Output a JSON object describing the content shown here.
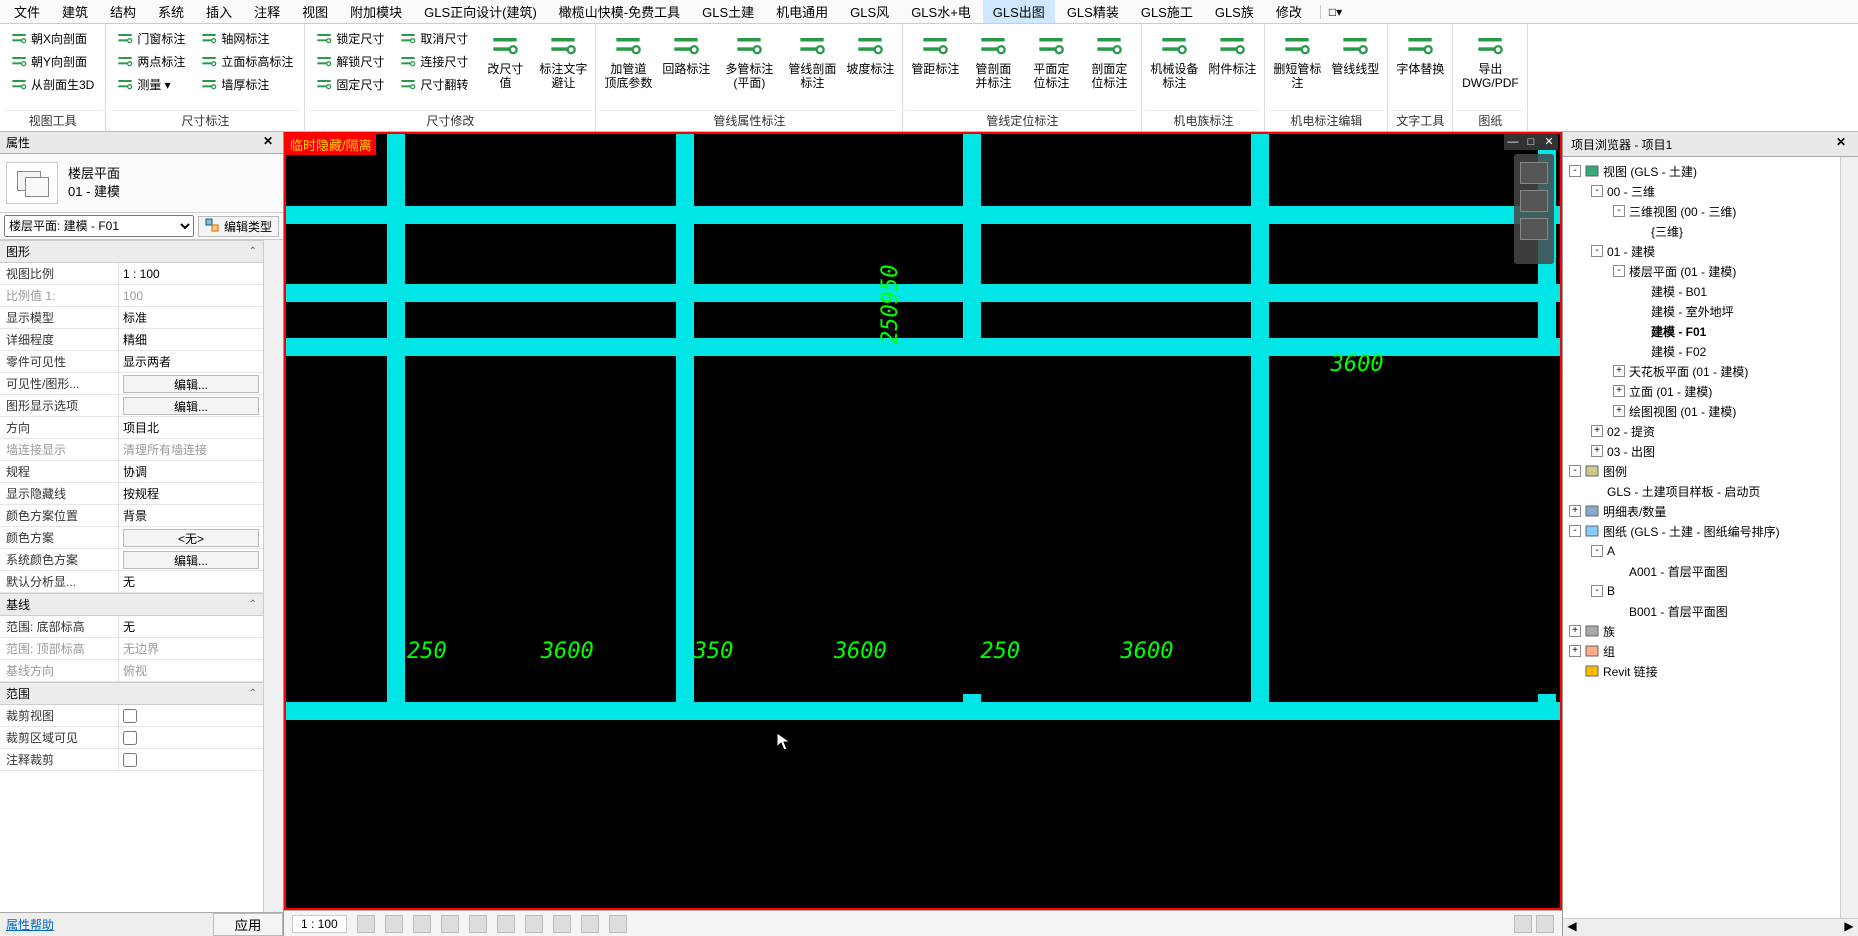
{
  "menu": {
    "items": [
      "文件",
      "建筑",
      "结构",
      "系统",
      "插入",
      "注释",
      "视图",
      "附加模块",
      "GLS正向设计(建筑)",
      "橄榄山快模-免费工具",
      "GLS土建",
      "机电通用",
      "GLS风",
      "GLS水+电",
      "GLS出图",
      "GLS精装",
      "GLS施工",
      "GLS族",
      "修改"
    ],
    "active": "GLS出图",
    "dropdown": "□▾"
  },
  "ribbon": {
    "groups": [
      {
        "title": "视图工具",
        "small": [
          {
            "label": "朝X向剖面",
            "icon": "sec-x"
          },
          {
            "label": "朝Y向剖面",
            "icon": "sec-y"
          },
          {
            "label": "从剖面生3D",
            "icon": "sec-3d"
          }
        ]
      },
      {
        "title": "尺寸标注",
        "small_cols": [
          [
            {
              "label": "门窗标注",
              "icon": "door"
            },
            {
              "label": "两点标注",
              "icon": "twopt"
            },
            {
              "label": "测量",
              "suffix": " ▾",
              "icon": "measure"
            }
          ],
          [
            {
              "label": "轴网标注",
              "icon": "grid"
            },
            {
              "label": "立面标高标注",
              "icon": "elev"
            },
            {
              "label": "墙厚标注",
              "icon": "wall"
            }
          ]
        ]
      },
      {
        "title": "尺寸修改",
        "big": [
          {
            "label": "改尺寸\n值",
            "icon": "editdim"
          },
          {
            "label": "标注文字\n避让",
            "icon": "avoidtxt"
          }
        ],
        "small_cols": [
          [
            {
              "label": "锁定尺寸",
              "icon": "lock"
            },
            {
              "label": "解锁尺寸",
              "icon": "unlock"
            },
            {
              "label": "固定尺寸",
              "icon": "fix"
            }
          ],
          [
            {
              "label": "取消尺寸",
              "icon": "cancel"
            },
            {
              "label": "连接尺寸",
              "icon": "join"
            },
            {
              "label": "尺寸翻转",
              "icon": "flip"
            }
          ]
        ]
      },
      {
        "title": "管线属性标注",
        "big": [
          {
            "label": "加管道\n顶底参数",
            "icon": "pipe-add"
          },
          {
            "label": "回路标注",
            "icon": "loop"
          },
          {
            "label": "多管标注(平面)",
            "icon": "multi-plan",
            "wide": true
          },
          {
            "label": "管线剖面\n标注",
            "icon": "pipe-sec"
          },
          {
            "label": "坡度标注",
            "icon": "slope"
          }
        ]
      },
      {
        "title": "管线定位标注",
        "big": [
          {
            "label": "管距标注",
            "icon": "pipe-dist"
          },
          {
            "label": "管剖面\n并标注",
            "icon": "pipe-merge"
          },
          {
            "label": "平面定\n位标注",
            "icon": "plan-loc"
          },
          {
            "label": "剖面定\n位标注",
            "icon": "sec-loc"
          }
        ]
      },
      {
        "title": "机电族标注",
        "big": [
          {
            "label": "机械设备\n标注",
            "icon": "mech"
          },
          {
            "label": "附件标注",
            "icon": "attach"
          }
        ]
      },
      {
        "title": "机电标注编辑",
        "big": [
          {
            "label": "删短管标注",
            "icon": "delshort"
          },
          {
            "label": "管线线型",
            "icon": "linepat"
          }
        ]
      },
      {
        "title": "文字工具",
        "big": [
          {
            "label": "字体替换",
            "icon": "font"
          }
        ]
      },
      {
        "title": "图纸",
        "big": [
          {
            "label": "导出DWG/PDF",
            "icon": "export",
            "wide": true
          }
        ]
      }
    ]
  },
  "props_panel": {
    "title": "属性",
    "type_name": "楼层平面",
    "type_sub": "01 - 建模",
    "selector": "楼层平面: 建模 - F01",
    "edit_type": "编辑类型",
    "sections": {
      "graphics": {
        "header": "图形",
        "rows": [
          {
            "label": "视图比例",
            "value": "1 : 100",
            "kind": "text"
          },
          {
            "label": "比例值 1:",
            "value": "100",
            "kind": "text",
            "dim": true
          },
          {
            "label": "显示模型",
            "value": "标准",
            "kind": "text"
          },
          {
            "label": "详细程度",
            "value": "精细",
            "kind": "text"
          },
          {
            "label": "零件可见性",
            "value": "显示两者",
            "kind": "text"
          },
          {
            "label": "可见性/图形...",
            "value": "编辑...",
            "kind": "btn"
          },
          {
            "label": "图形显示选项",
            "value": "编辑...",
            "kind": "btn"
          },
          {
            "label": "方向",
            "value": "项目北",
            "kind": "text"
          },
          {
            "label": "墙连接显示",
            "value": "清理所有墙连接",
            "kind": "text",
            "dim": true
          },
          {
            "label": "规程",
            "value": "协调",
            "kind": "text"
          },
          {
            "label": "显示隐藏线",
            "value": "按规程",
            "kind": "text"
          },
          {
            "label": "颜色方案位置",
            "value": "背景",
            "kind": "text"
          },
          {
            "label": "颜色方案",
            "value": "<无>",
            "kind": "btn"
          },
          {
            "label": "系统颜色方案",
            "value": "编辑...",
            "kind": "btn"
          },
          {
            "label": "默认分析显...",
            "value": "无",
            "kind": "text"
          }
        ]
      },
      "baseline": {
        "header": "基线",
        "rows": [
          {
            "label": "范围: 底部标高",
            "value": "无",
            "kind": "text"
          },
          {
            "label": "范围: 顶部标高",
            "value": "无边界",
            "kind": "text",
            "dim": true
          },
          {
            "label": "基线方向",
            "value": "俯视",
            "kind": "text",
            "dim": true
          }
        ]
      },
      "range": {
        "header": "范围",
        "rows": [
          {
            "label": "裁剪视图",
            "value": "",
            "kind": "check",
            "checked": false
          },
          {
            "label": "裁剪区域可见",
            "value": "",
            "kind": "check",
            "checked": false
          },
          {
            "label": "注释裁剪",
            "value": "",
            "kind": "check",
            "checked": false
          }
        ]
      }
    },
    "help": "属性帮助",
    "apply": "应用"
  },
  "canvas": {
    "banner": "临时隐藏/隔离",
    "dims": {
      "vert": "250950",
      "h": [
        "250",
        "3600",
        "350",
        "3600",
        "250",
        "3600",
        "3600"
      ]
    },
    "scale": "1 : 100"
  },
  "browser": {
    "title": "项目浏览器 - 项目1",
    "tree": [
      {
        "d": 0,
        "exp": "-",
        "icon": "views",
        "label": "视图 (GLS - 土建)"
      },
      {
        "d": 1,
        "exp": "-",
        "label": "00 - 三维"
      },
      {
        "d": 2,
        "exp": "-",
        "label": "三维视图 (00 - 三维)"
      },
      {
        "d": 3,
        "exp": "",
        "label": "{三维}"
      },
      {
        "d": 1,
        "exp": "-",
        "label": "01 - 建模"
      },
      {
        "d": 2,
        "exp": "-",
        "label": "楼层平面 (01 - 建模)"
      },
      {
        "d": 3,
        "exp": "",
        "label": "建模 - B01"
      },
      {
        "d": 3,
        "exp": "",
        "label": "建模 - 室外地坪"
      },
      {
        "d": 3,
        "exp": "",
        "label": "建模 - F01",
        "bold": true
      },
      {
        "d": 3,
        "exp": "",
        "label": "建模 - F02"
      },
      {
        "d": 2,
        "exp": "+",
        "label": "天花板平面 (01 - 建模)"
      },
      {
        "d": 2,
        "exp": "+",
        "label": "立面 (01 - 建模)"
      },
      {
        "d": 2,
        "exp": "+",
        "label": "绘图视图 (01 - 建模)"
      },
      {
        "d": 1,
        "exp": "+",
        "label": "02 - 提资"
      },
      {
        "d": 1,
        "exp": "+",
        "label": "03 - 出图"
      },
      {
        "d": 0,
        "exp": "-",
        "icon": "legend",
        "label": "图例"
      },
      {
        "d": 1,
        "exp": "",
        "label": "GLS - 土建项目样板 - 启动页"
      },
      {
        "d": 0,
        "exp": "+",
        "icon": "sched",
        "label": "明细表/数量"
      },
      {
        "d": 0,
        "exp": "-",
        "icon": "sheet",
        "label": "图纸 (GLS - 土建 - 图纸编号排序)"
      },
      {
        "d": 1,
        "exp": "-",
        "label": "A"
      },
      {
        "d": 2,
        "exp": "",
        "label": "A001 - 首层平面图"
      },
      {
        "d": 1,
        "exp": "-",
        "label": "B"
      },
      {
        "d": 2,
        "exp": "",
        "label": "B001 - 首层平面图"
      },
      {
        "d": 0,
        "exp": "+",
        "icon": "fam",
        "label": "族"
      },
      {
        "d": 0,
        "exp": "+",
        "icon": "grp",
        "label": "组"
      },
      {
        "d": 0,
        "exp": "",
        "icon": "link",
        "label": "Revit 链接"
      }
    ]
  }
}
